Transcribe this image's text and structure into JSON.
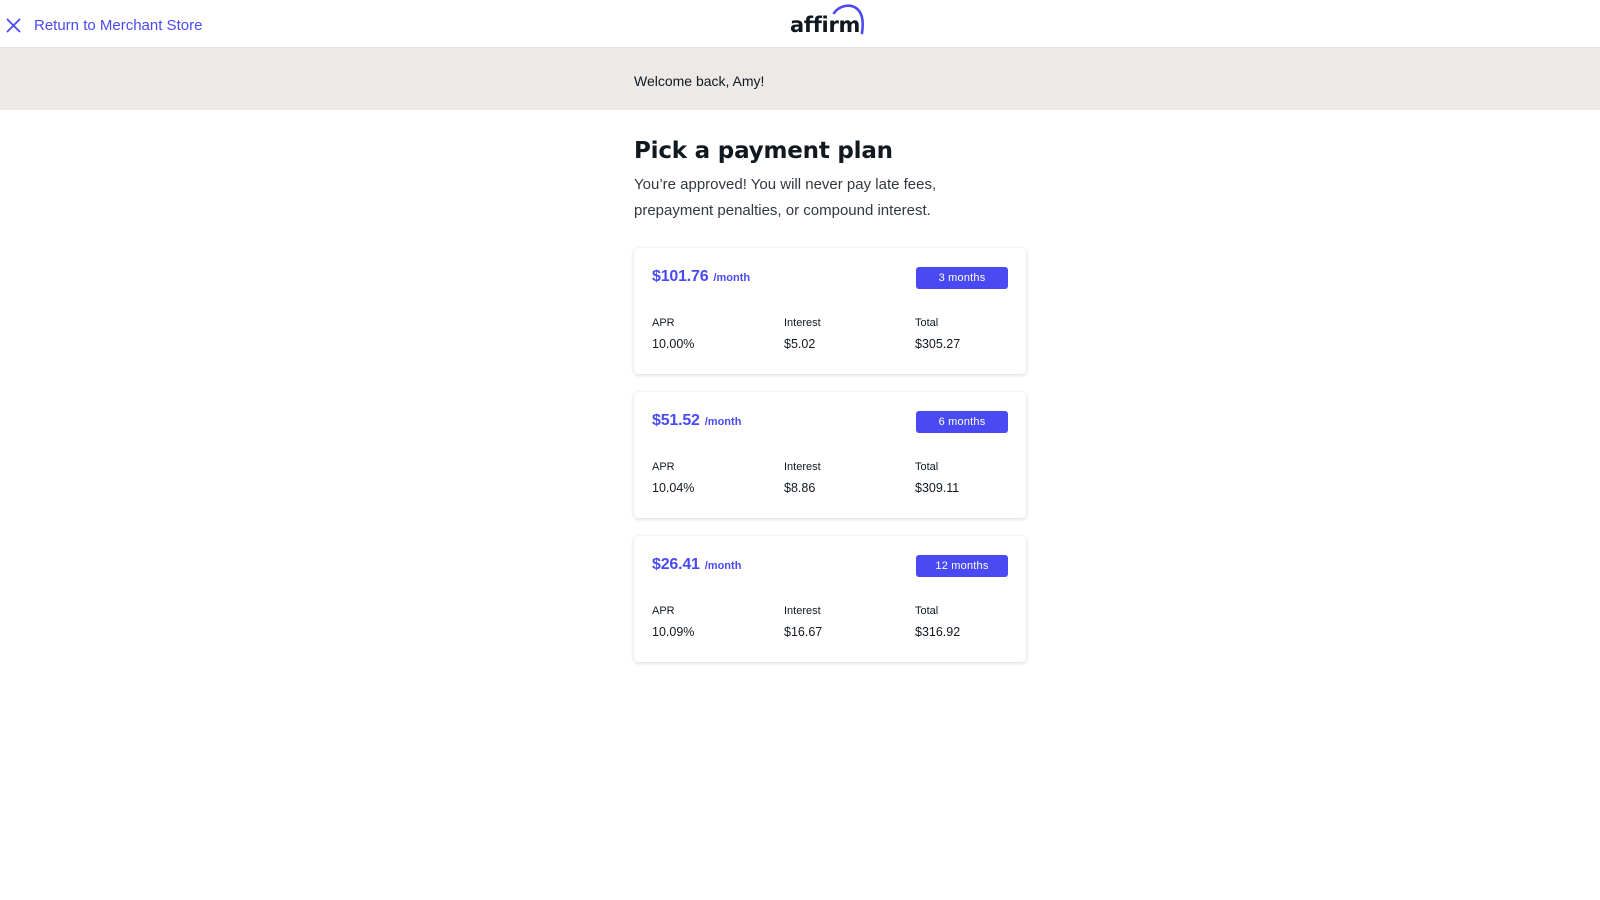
{
  "header": {
    "return_label": "Return to Merchant Store",
    "logo_text": "affirm",
    "brand_color": "#4a4af4"
  },
  "welcome": {
    "text": "Welcome back, Amy!"
  },
  "main": {
    "title": "Pick a payment plan",
    "subtitle": "You’re approved! You will never pay late fees, prepayment penalties, or compound interest."
  },
  "plans": [
    {
      "price": "$101.76",
      "unit": "/month",
      "term": "3 months",
      "apr_label": "APR",
      "apr": "10.00%",
      "interest_label": "Interest",
      "interest": "$5.02",
      "total_label": "Total",
      "total": "$305.27"
    },
    {
      "price": "$51.52",
      "unit": "/month",
      "term": "6 months",
      "apr_label": "APR",
      "apr": "10.04%",
      "interest_label": "Interest",
      "interest": "$8.86",
      "total_label": "Total",
      "total": "$309.11"
    },
    {
      "price": "$26.41",
      "unit": "/month",
      "term": "12 months",
      "apr_label": "APR",
      "apr": "10.09%",
      "interest_label": "Interest",
      "interest": "$16.67",
      "total_label": "Total",
      "total": "$316.92"
    }
  ]
}
